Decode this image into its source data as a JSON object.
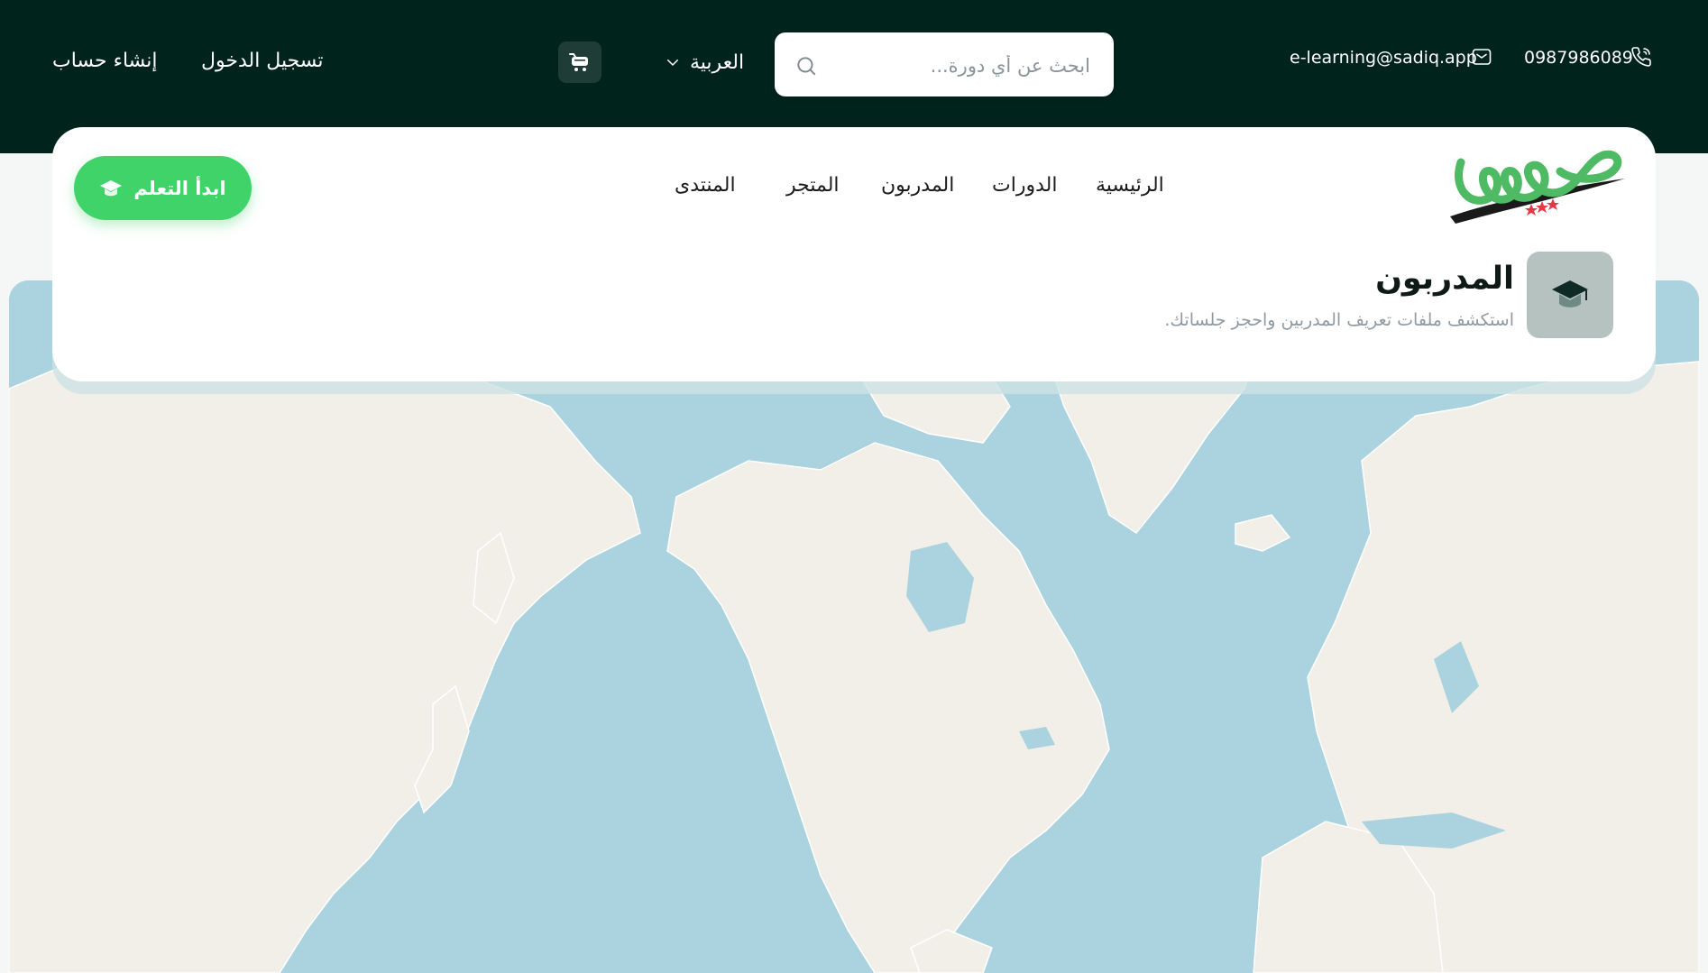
{
  "topbar": {
    "phone": "0987986089",
    "email": "e-learning@sadiq.app",
    "search_placeholder": "ابحث عن أي دورة...",
    "language": "العربية",
    "login_label": "تسجيل الدخول",
    "signup_label": "إنشاء حساب",
    "icons": [
      "phone-icon",
      "mail-icon",
      "search-icon",
      "chevron-down-icon",
      "cart-icon"
    ]
  },
  "nav": {
    "items": [
      "الرئيسية",
      "الدورات",
      "المدربون",
      "المتجر",
      "المنتدى"
    ],
    "cta_label": "ابدأ التعلم"
  },
  "page": {
    "title": "المدربون",
    "subtitle": "استكشف ملفات تعريف المدربين واحجز جلساتك."
  },
  "colors": {
    "topbar_bg": "#00231c",
    "accent_green": "#40d36a",
    "map_water": "#aad3df",
    "map_land": "#f2efe9"
  }
}
